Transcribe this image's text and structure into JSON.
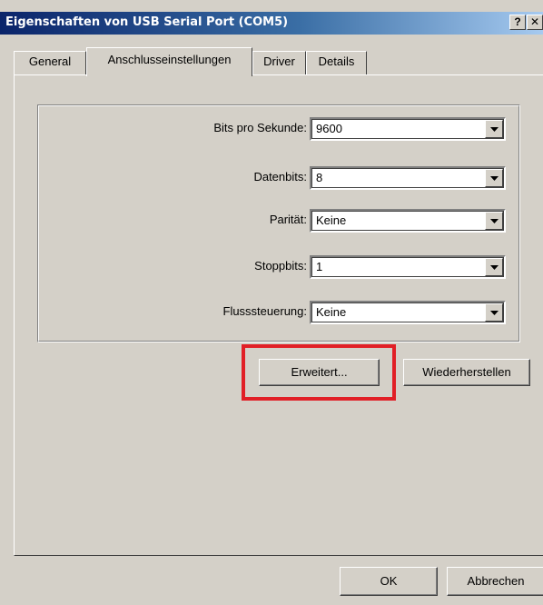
{
  "window": {
    "title": "Eigenschaften von USB Serial Port (COM5)",
    "help_button": "?",
    "close_button": "✕"
  },
  "tabs": [
    {
      "label": "General",
      "active": false
    },
    {
      "label": "Anschlusseinstellungen",
      "active": true
    },
    {
      "label": "Driver",
      "active": false
    },
    {
      "label": "Details",
      "active": false
    }
  ],
  "settings": {
    "bits_per_second": {
      "label": "Bits pro Sekunde:",
      "value": "9600"
    },
    "data_bits": {
      "label": "Datenbits:",
      "value": "8"
    },
    "parity": {
      "label": "Parität:",
      "value": "Keine"
    },
    "stop_bits": {
      "label": "Stoppbits:",
      "value": "1"
    },
    "flow_control": {
      "label": "Flusssteuerung:",
      "value": "Keine"
    }
  },
  "buttons": {
    "advanced": "Erweitert...",
    "restore": "Wiederherstellen",
    "ok": "OK",
    "cancel": "Abbrechen"
  },
  "colors": {
    "highlight": "#e11f26",
    "titlebar": "#0a246a",
    "face": "#d4d0c8"
  }
}
